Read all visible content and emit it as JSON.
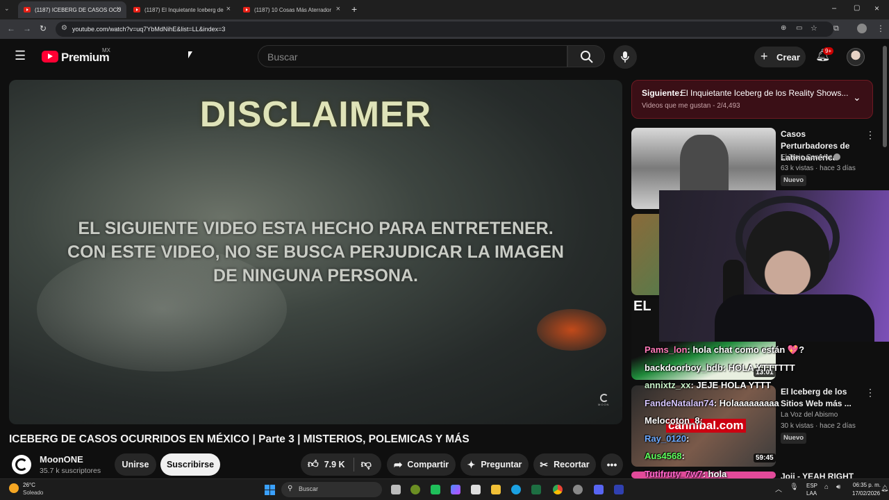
{
  "browser": {
    "tabs": [
      {
        "label": "(1187) ICEBERG DE CASOS OCU",
        "active": true
      },
      {
        "label": "(1187) El Inquietante Iceberg de",
        "active": false
      },
      {
        "label": "(1187) 10 Cosas Más Aterrador",
        "active": false
      }
    ],
    "url": "youtube.com/watch?v=uq7YbMdNihE&list=LL&index=3"
  },
  "youtube_header": {
    "logo_text": "Premium",
    "logo_region": "MX",
    "search_placeholder": "Buscar",
    "create_label": "Crear",
    "notification_count": "9+"
  },
  "video": {
    "overlay_heading": "DISCLAIMER",
    "overlay_lines": [
      "EL SIGUIENTE VIDEO ESTA HECHO PARA ENTRETENER.",
      "CON ESTE VIDEO, NO SE BUSCA PERJUDICAR LA IMAGEN",
      "DE NINGUNA PERSONA."
    ],
    "watermark": "MOON",
    "title": "ICEBERG DE CASOS OCURRIDOS EN MÉXICO | Parte 3 | MISTERIOS, POLEMICAS Y MÁS",
    "channel_name": "MoonONE",
    "subscribers": "35.7 k suscriptores",
    "join_label": "Unirse",
    "subscribe_label": "Suscribirse",
    "likes": "7.9 K",
    "share_label": "Compartir",
    "ask_label": "Preguntar",
    "clip_label": "Recortar"
  },
  "playlist_next": {
    "prefix": "Siguiente:",
    "title": "El Inquietante Iceberg de los Reality Shows...",
    "meta": "Videos que me gustan - 2/4,493"
  },
  "recommendations": [
    {
      "title": "Casos Perturbadores de Latinoamérica",
      "channel": "El Traje Con Voz",
      "meta": "63 k vistas · hace 3 días",
      "badge": "Nuevo"
    },
    {
      "thumb_text": "EL",
      "duration": "13:01"
    },
    {
      "title": "El Iceberg de los Sitios Web más ...",
      "channel": "La Voz del Abismo",
      "meta": "30 k vistas · hace 2 días",
      "badge": "Nuevo",
      "duration": "59:45",
      "thumb_text": "cannibal.com"
    },
    {
      "title": "Joji - YEAH RIGHT"
    }
  ],
  "chat": [
    {
      "user": "Pams_lon",
      "text": ": hola chat como están 💖?",
      "color": "#ff7ab8"
    },
    {
      "user": "backdoorboy_bdb",
      "text": ": HOLA YTTTTTT",
      "color": "#ffffff"
    },
    {
      "user": "annixtz_xx",
      "text": ": JEJE HOLA YTTT",
      "color": "#c8f0c8"
    },
    {
      "user": "FandeNatalan74",
      "text": ": Holaaaaaaaaa",
      "color": "#d7c6ff"
    },
    {
      "user": "Melocoton_8",
      "text": ":",
      "color": "#ffffff"
    },
    {
      "user": "Ray_0120",
      "text": ":",
      "color": "#6aa8ff"
    },
    {
      "user": "Aus4568",
      "text": ":",
      "color": "#5cff5c"
    },
    {
      "user": "Tutifruty_7w7",
      "text": ": hola",
      "color": "#ff66cc"
    }
  ],
  "taskbar": {
    "weather_temp": "26°C",
    "weather_text": "Soleado",
    "search_label": "Buscar",
    "language": "ESP",
    "region": "LAA",
    "time": "06:35 p. m.",
    "date": "17/02/2026"
  },
  "colors": {
    "accent_red": "#ff0033",
    "next_bg": "#3a0f16"
  }
}
